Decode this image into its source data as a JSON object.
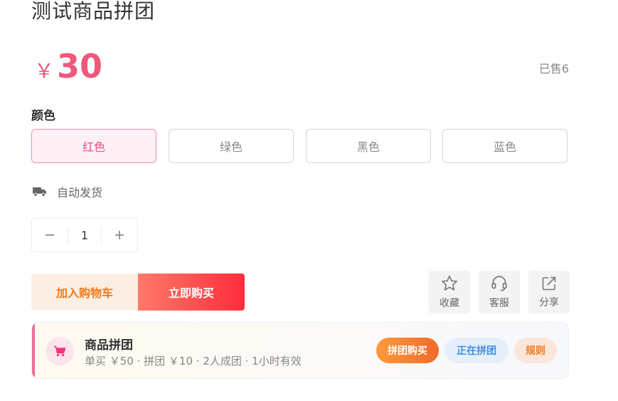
{
  "product": {
    "title": "测试商品拼团",
    "currency": "￥",
    "price": "30",
    "sold_text": "已售6"
  },
  "spec": {
    "label": "颜色",
    "options": [
      "红色",
      "绿色",
      "黑色",
      "蓝色"
    ],
    "selected": "红色"
  },
  "delivery": {
    "text": "自动发货",
    "icon": "truck-icon"
  },
  "stepper": {
    "quantity": "1"
  },
  "actions": {
    "add_to_cart": "加入购物车",
    "buy_now": "立即购买",
    "favorite": "收藏",
    "service": "客服",
    "share": "分享"
  },
  "group_buy": {
    "title": "商品拼团",
    "description": "单买 ￥50 · 拼团 ￥10 · 2人成团 · 1小时有效",
    "buy_button": "拼团购买",
    "in_progress_button": "正在拼团",
    "rules_button": "规则"
  },
  "colors": {
    "accent": "#f0577a",
    "buy_gradient_end": "#fd2d3a",
    "cart_text": "#f07a1c"
  }
}
